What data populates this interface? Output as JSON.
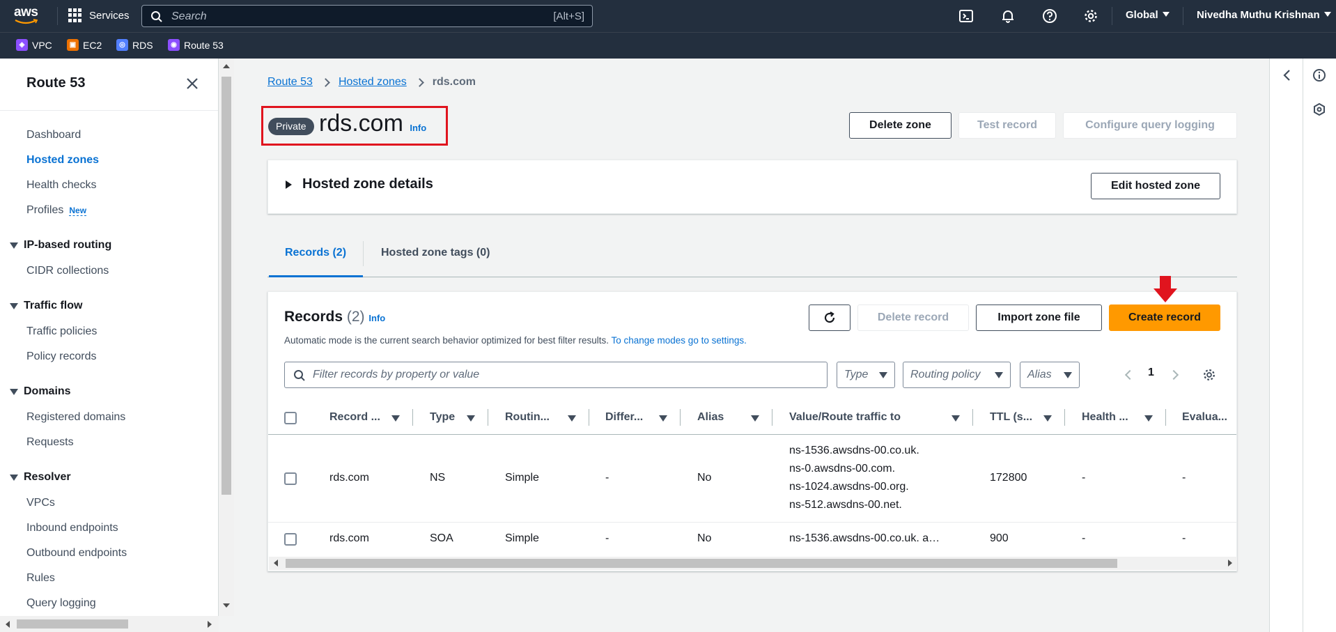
{
  "topnav": {
    "logo_text": "aws",
    "services_label": "Services",
    "search_placeholder": "Search",
    "search_shortcut": "[Alt+S]",
    "region_label": "Global",
    "user_name": "Nivedha Muthu Krishnan"
  },
  "favorites": [
    {
      "label": "VPC",
      "color": "#8c4fff"
    },
    {
      "label": "EC2",
      "color": "#ed7100"
    },
    {
      "label": "RDS",
      "color": "#527fff"
    },
    {
      "label": "Route 53",
      "color": "#8c4fff"
    }
  ],
  "sidebar": {
    "title": "Route 53",
    "items": {
      "dashboard": "Dashboard",
      "hosted_zones": "Hosted zones",
      "health_checks": "Health checks",
      "profiles": "Profiles",
      "profiles_badge": "New",
      "ip_routing_section": "IP-based routing",
      "cidr_collections": "CIDR collections",
      "traffic_flow_section": "Traffic flow",
      "traffic_policies": "Traffic policies",
      "policy_records": "Policy records",
      "domains_section": "Domains",
      "registered_domains": "Registered domains",
      "requests": "Requests",
      "resolver_section": "Resolver",
      "vpcs": "VPCs",
      "inbound_endpoints": "Inbound endpoints",
      "outbound_endpoints": "Outbound endpoints",
      "rules": "Rules",
      "query_logging": "Query logging"
    }
  },
  "breadcrumb": {
    "root": "Route 53",
    "parent": "Hosted zones",
    "current": "rds.com"
  },
  "header": {
    "badge": "Private",
    "title": "rds.com",
    "info": "Info",
    "delete_zone": "Delete zone",
    "test_record": "Test record",
    "configure_query_logging": "Configure query logging"
  },
  "details_panel": {
    "title": "Hosted zone details",
    "edit_button": "Edit hosted zone"
  },
  "tabs": {
    "records": "Records (2)",
    "tags": "Hosted zone tags (0)"
  },
  "records": {
    "title": "Records",
    "count": "(2)",
    "info": "Info",
    "description": "Automatic mode is the current search behavior optimized for best filter results.",
    "description_link": "To change modes go to settings.",
    "delete_record": "Delete record",
    "import_zone_file": "Import zone file",
    "create_record": "Create record",
    "filter_placeholder": "Filter records by property or value",
    "type_filter": "Type",
    "routing_filter": "Routing policy",
    "alias_filter": "Alias",
    "page": "1",
    "columns": {
      "name": "Record ...",
      "type": "Type",
      "routing": "Routin...",
      "differ": "Differ...",
      "alias": "Alias",
      "value": "Value/Route traffic to",
      "ttl": "TTL (s...",
      "health": "Health ...",
      "eval": "Evalua..."
    },
    "rows": [
      {
        "name": "rds.com",
        "type": "NS",
        "routing": "Simple",
        "differ": "-",
        "alias": "No",
        "value1": "ns-1536.awsdns-00.co.uk.",
        "value2": "ns-0.awsdns-00.com.",
        "value3": "ns-1024.awsdns-00.org.",
        "value4": "ns-512.awsdns-00.net.",
        "ttl": "172800",
        "health": "-",
        "eval": "-"
      },
      {
        "name": "rds.com",
        "type": "SOA",
        "routing": "Simple",
        "differ": "-",
        "alias": "No",
        "value1": "ns-1536.awsdns-00.co.uk. a…",
        "ttl": "900",
        "health": "-",
        "eval": "-"
      }
    ]
  },
  "colors": {
    "accent": "#0972d3",
    "primary_button": "#ff9900",
    "highlight": "#e0141e",
    "topbar": "#232f3e"
  }
}
